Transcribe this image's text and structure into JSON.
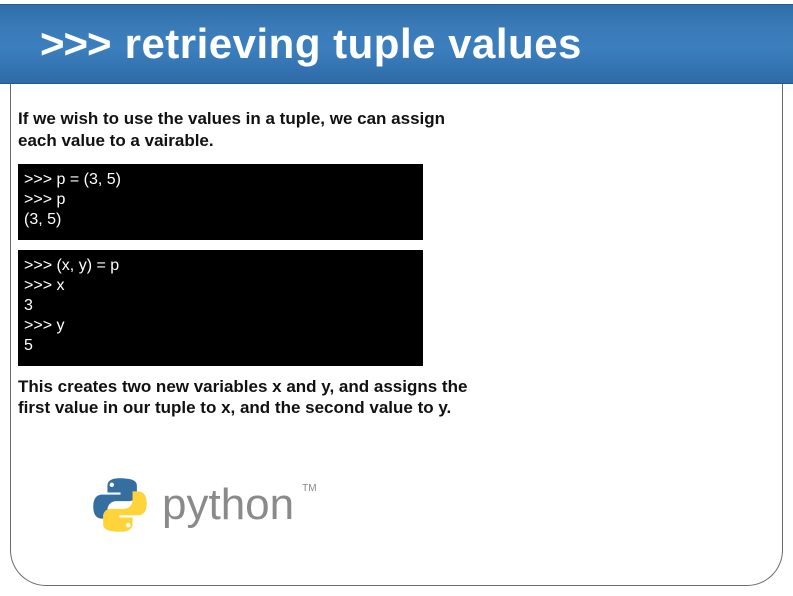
{
  "header": {
    "prompt": ">>>",
    "title": "retrieving tuple values"
  },
  "body": {
    "intro": "If we wish to use the values in a tuple, we can assign each value to a vairable.",
    "code1": ">>> p = (3, 5)\n>>> p\n(3, 5)",
    "code2": ">>> (x, y) = p\n>>> x\n3\n>>> y\n5",
    "outro": "This creates two new variables x and y, and assigns the first value in our tuple to x, and the second value to y."
  },
  "logo": {
    "wordmark": "python",
    "tm": "TM",
    "colors": {
      "blue": "#356f9f",
      "yellow": "#ffd43b",
      "text": "#8a8a8a"
    }
  }
}
